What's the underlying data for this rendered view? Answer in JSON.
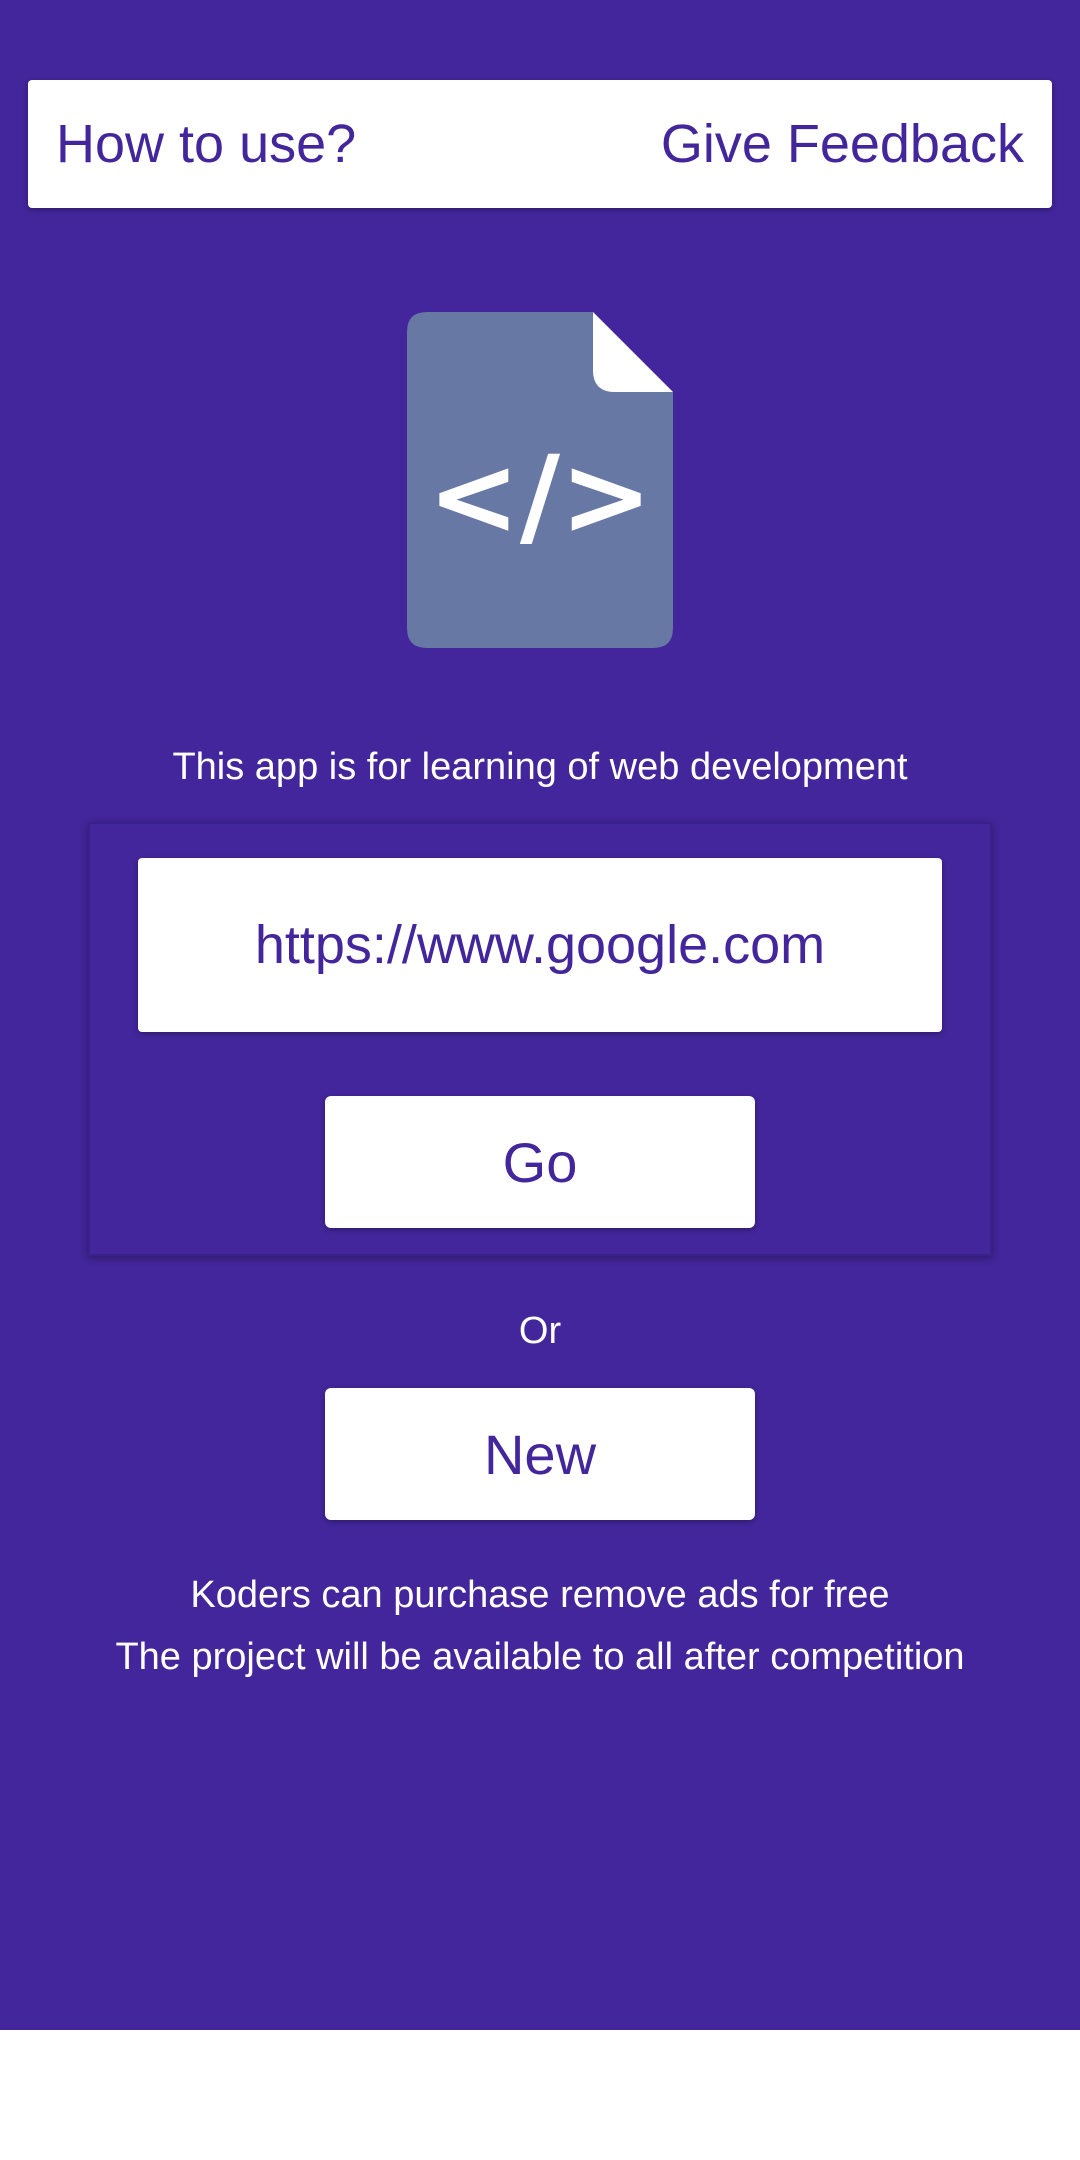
{
  "header": {
    "how_to_use": "How to use?",
    "give_feedback": "Give Feedback"
  },
  "icon": {
    "name": "code-file-icon",
    "glyph": "</>"
  },
  "intro": {
    "text": "This app is for learning of web development"
  },
  "form": {
    "url_value": "https://www.google.com",
    "go_label": "Go"
  },
  "or_label": "Or",
  "new_label": "New",
  "footer": {
    "line1": "Koders can purchase remove ads for free",
    "line2": "The project will be available to all after competition"
  },
  "colors": {
    "background": "#43269b",
    "icon_fill": "#6678a3",
    "accent_text": "#43269b",
    "card": "#ffffff"
  }
}
